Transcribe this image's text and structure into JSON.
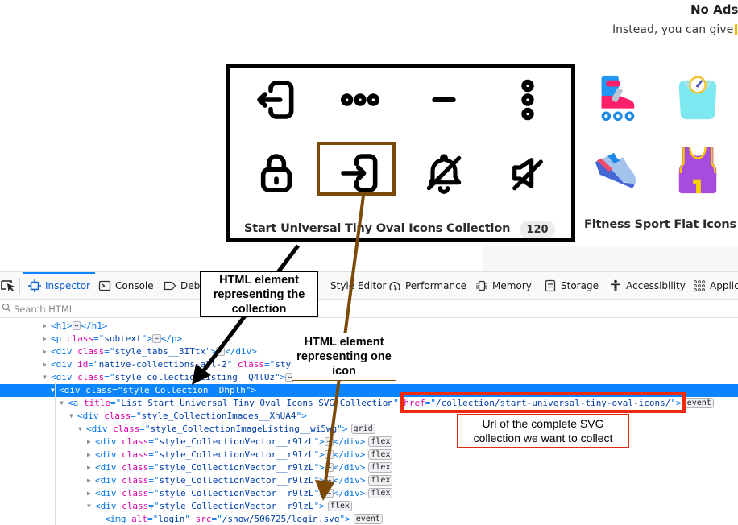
{
  "page": {
    "banner": {
      "title": "No Ads",
      "subtitle": "Instead, you can give"
    },
    "collections": [
      {
        "title": "Start Universal Tiny Oval Icons Collection",
        "count": "120",
        "icons": [
          "logout-icon",
          "more-horizontal-icon",
          "minus-icon",
          "more-vertical-icon",
          "lock-icon",
          "login-icon",
          "bell-off-icon",
          "volume-off-icon"
        ]
      },
      {
        "title": "Fitness Sport Flat Icons Co",
        "icons": [
          "roller-skate-icon",
          "weight-scale-icon",
          "sneaker-icon",
          "jersey-icon"
        ]
      }
    ]
  },
  "devtools": {
    "tabs": [
      {
        "label": "Inspector",
        "icon": "inspector-icon",
        "active": true
      },
      {
        "label": "Console",
        "icon": "console-icon"
      },
      {
        "label": "Debugger",
        "icon": "debugger-icon"
      },
      {
        "label": "Style Editor",
        "icon": "style-editor-icon"
      },
      {
        "label": "Performance",
        "icon": "performance-icon"
      },
      {
        "label": "Memory",
        "icon": "memory-icon"
      },
      {
        "label": "Storage",
        "icon": "storage-icon"
      },
      {
        "label": "Accessibility",
        "icon": "accessibility-icon"
      },
      {
        "label": "Applic",
        "icon": "application-icon"
      }
    ],
    "search_placeholder": "Search HTML",
    "tree": {
      "h1": "h1",
      "p_class": "subtext",
      "tabs_class": "style_tabs__3ITtx",
      "native_id": "native-collections-all-2",
      "native_class_partial": "sty",
      "listing_class": "style_collectionListing__Q4lUz",
      "collection_class": "style Collection  Dhplh",
      "a_title": "List Start Universal Tiny Oval Icons SVG Collection",
      "a_href": "/collection/start-universal-tiny-oval-icons/",
      "images_class": "style_CollectionImages__XhUA4",
      "image_listing_class": "style_CollectionImageListing__wi5wg",
      "vector_class": "style_CollectionVector__r9lzL",
      "img_alt": "login",
      "img_src": "/show/506725/login.svg",
      "badge_grid": "grid",
      "badge_flex": "flex",
      "badge_event": "event",
      "ellipsis": "⋯"
    }
  },
  "annotations": {
    "collection": "HTML element representing the collection",
    "icon": "HTML element representing one icon",
    "url": "Url of the complete SVG collection we want to collect"
  }
}
